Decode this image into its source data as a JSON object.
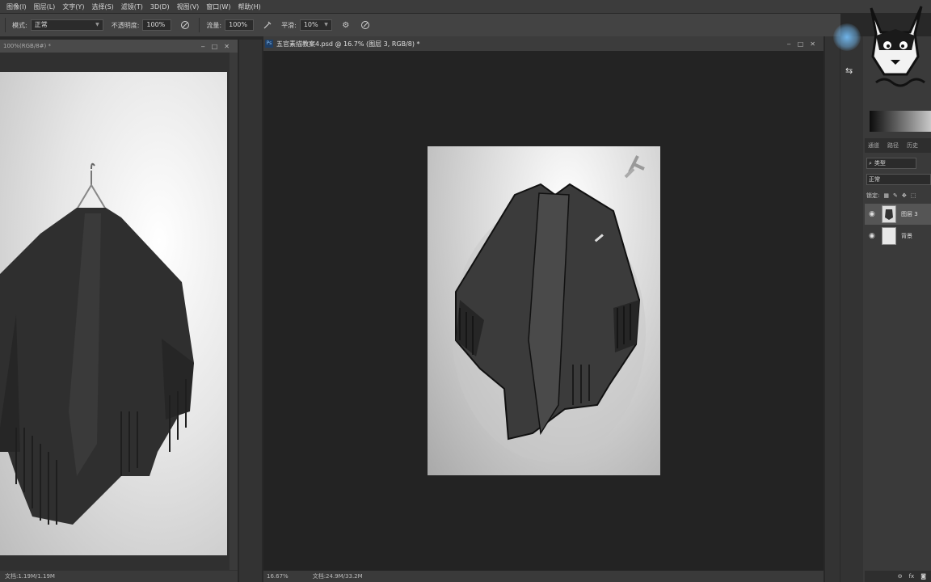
{
  "menu": [
    "图像(I)",
    "图层(L)",
    "文字(Y)",
    "选择(S)",
    "滤镜(T)",
    "3D(D)",
    "视图(V)",
    "窗口(W)",
    "帮助(H)"
  ],
  "options": {
    "mode_label": "模式:",
    "mode_value": "正常",
    "opacity_label": "不透明度:",
    "opacity_value": "100%",
    "flow_label": "流量:",
    "flow_value": "100%",
    "smoothing_label": "平滑:",
    "smoothing_value": "10%"
  },
  "left_doc": {
    "title": "100%(RGB/8#) *",
    "status": "文档:1.19M/1.19M"
  },
  "main_doc": {
    "tab_badge": "Ps",
    "tab_title": "五官素描教案4.psd @ 16.7% (图层 3, RGB/8) *",
    "zoom": "16.67%",
    "doc_info": "文档:24.9M/33.2M"
  },
  "panels": {
    "tabs": [
      "通道",
      "路径",
      "历史"
    ],
    "filter_label": "类型",
    "blend_mode": "正常",
    "lock_label": "锁定:",
    "layers": [
      {
        "name": "图层 3",
        "active": true
      },
      {
        "name": "背景",
        "active": false
      }
    ],
    "bottom_fx": "fx"
  }
}
